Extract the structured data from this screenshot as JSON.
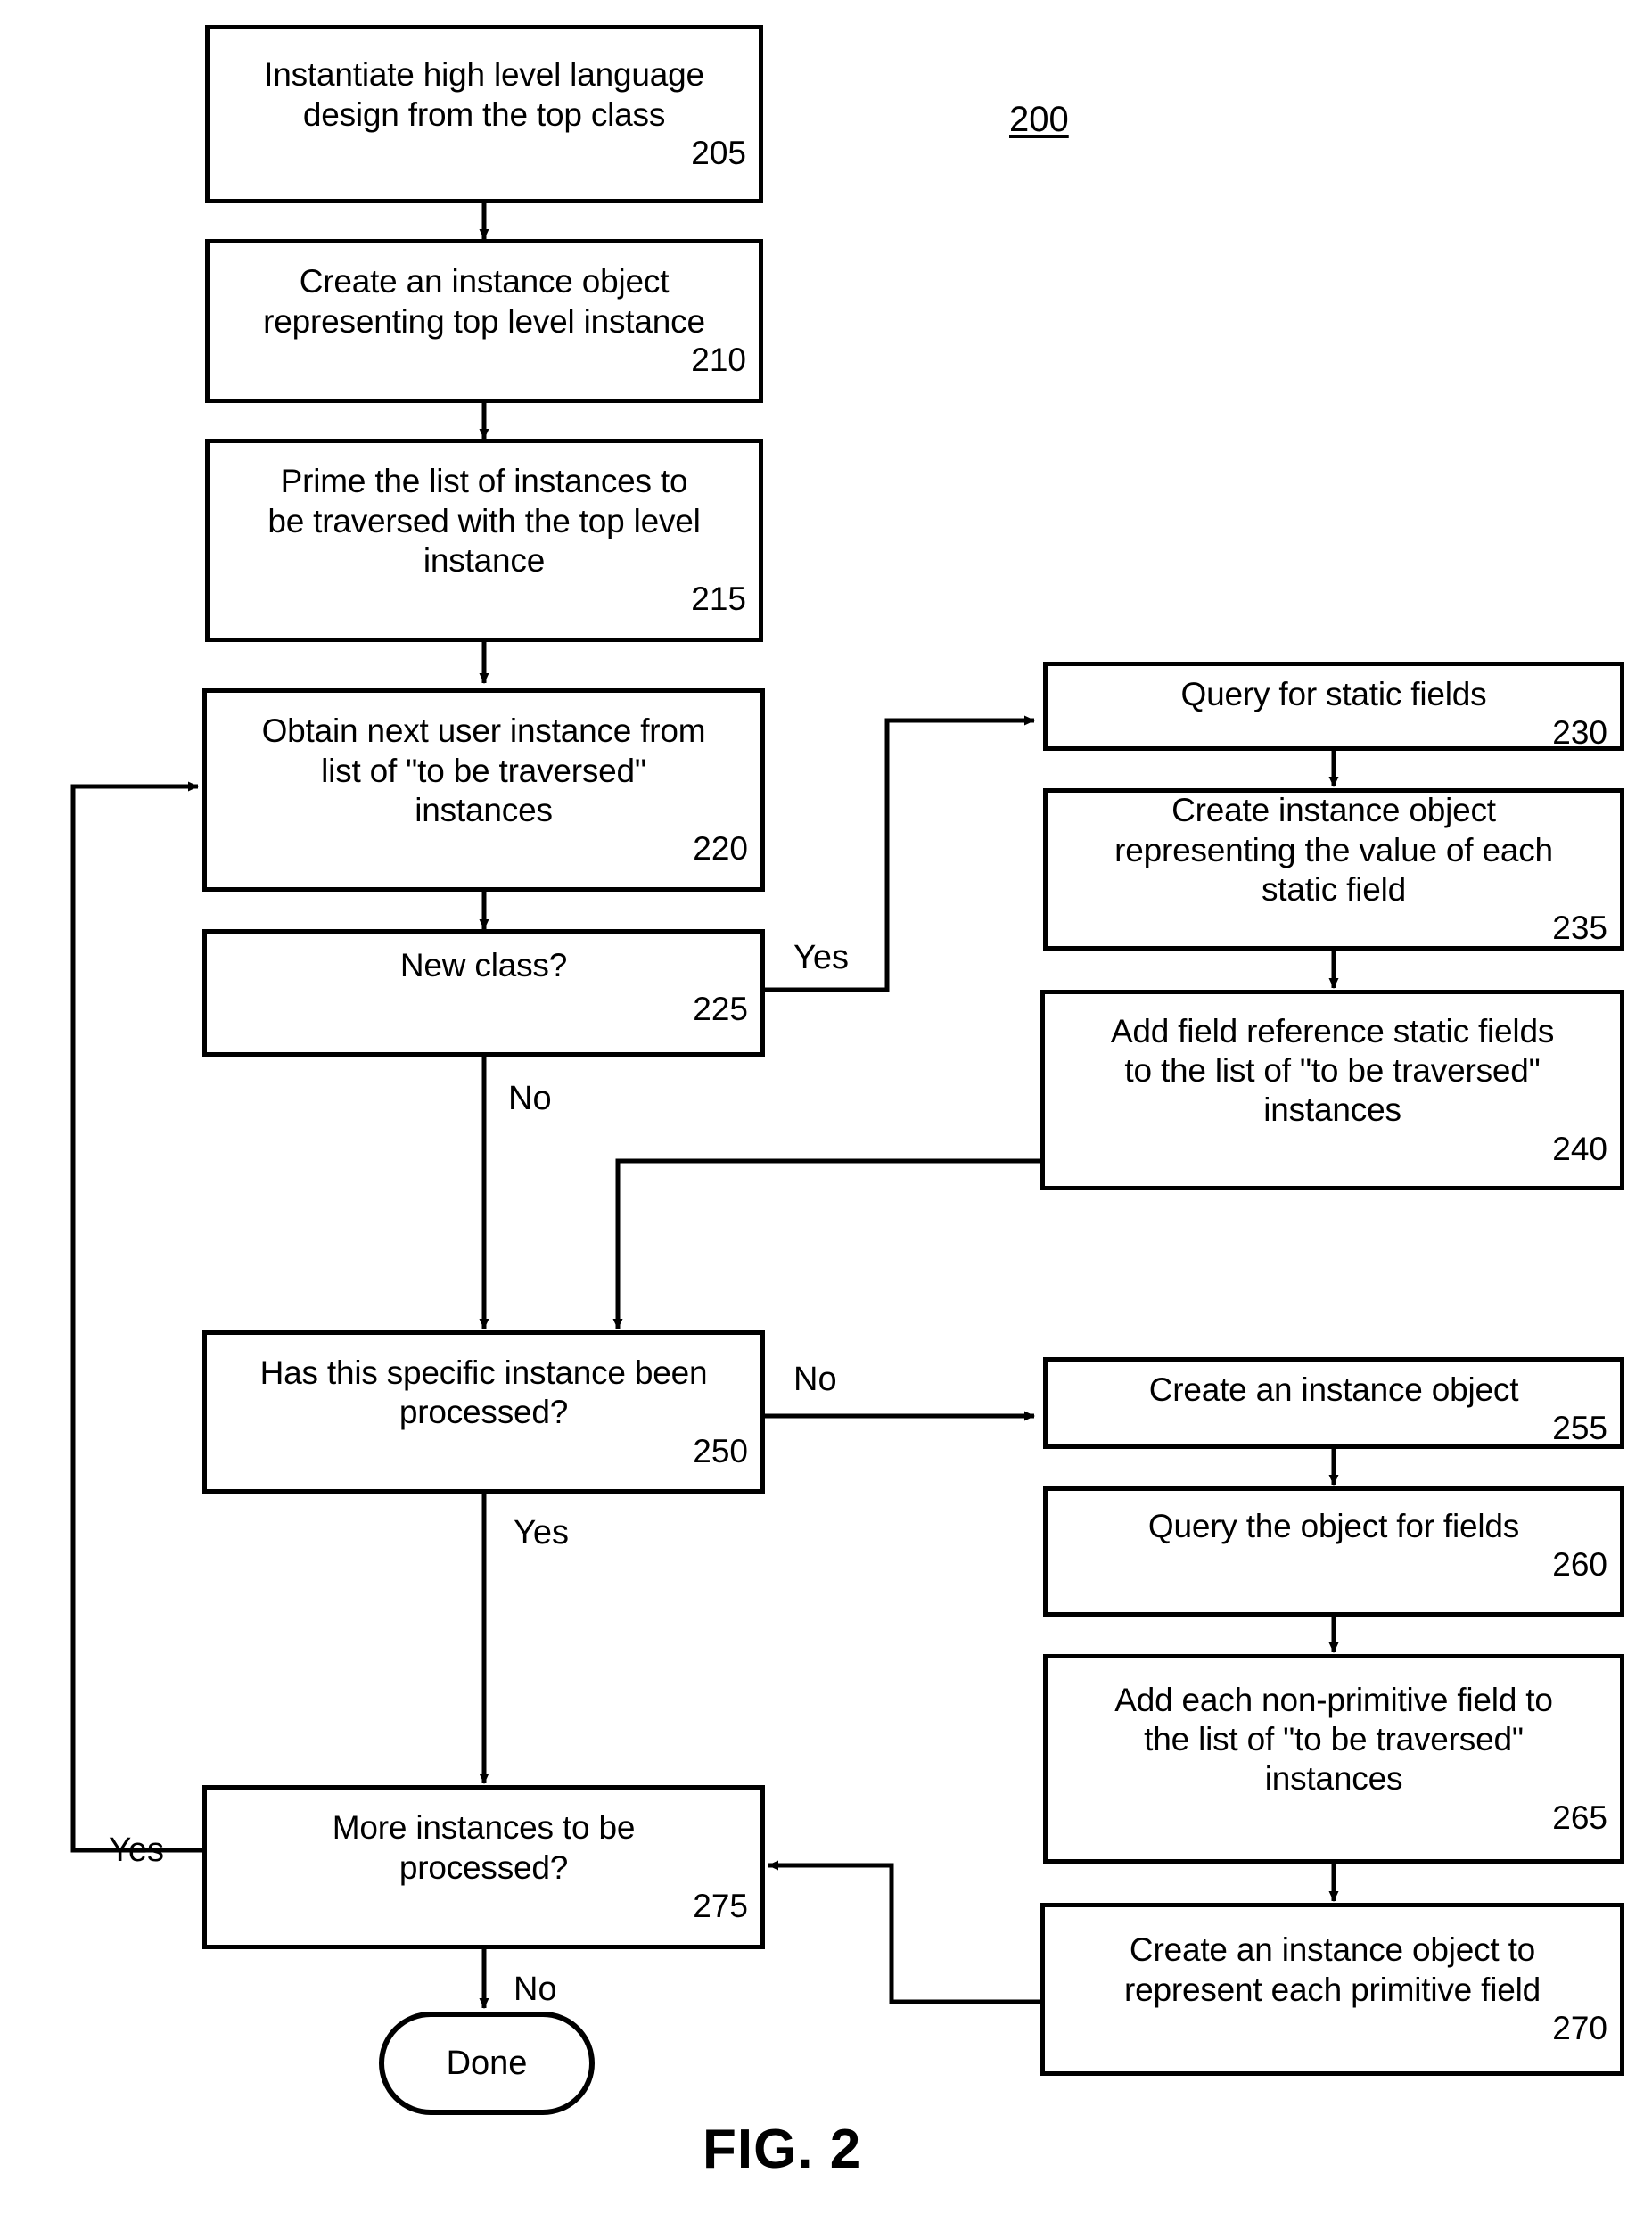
{
  "figure": {
    "caption": "FIG. 2",
    "reference_numeral": "200"
  },
  "nodes": [
    {
      "id": "205",
      "name": "instantiate-design",
      "text": "Instantiate high level language\ndesign from the top class",
      "ref": "205"
    },
    {
      "id": "210",
      "name": "create-top-level-instance-object",
      "text": "Create an instance object\nrepresenting top level instance",
      "ref": "210"
    },
    {
      "id": "215",
      "name": "prime-traversal-list",
      "text": "Prime the list of instances to\nbe traversed with the top level\ninstance",
      "ref": "215"
    },
    {
      "id": "220",
      "name": "obtain-next-user-instance",
      "text": "Obtain next user instance from\nlist of \"to be traversed\"\ninstances",
      "ref": "220"
    },
    {
      "id": "225",
      "name": "new-class-decision",
      "text": "New class?",
      "ref": "225"
    },
    {
      "id": "230",
      "name": "query-static-fields",
      "text": "Query for static fields",
      "ref": "230"
    },
    {
      "id": "235",
      "name": "create-static-field-value-object",
      "text": "Create instance object\nrepresenting the value of each\nstatic field",
      "ref": "235"
    },
    {
      "id": "240",
      "name": "add-field-reference-static-fields",
      "text": "Add field reference static fields\nto the list of \"to be traversed\"\ninstances",
      "ref": "240"
    },
    {
      "id": "250",
      "name": "instance-processed-decision",
      "text": "Has this specific instance been\nprocessed?",
      "ref": "250"
    },
    {
      "id": "255",
      "name": "create-instance-object",
      "text": "Create an instance object",
      "ref": "255"
    },
    {
      "id": "260",
      "name": "query-object-for-fields",
      "text": "Query the object for fields",
      "ref": "260"
    },
    {
      "id": "265",
      "name": "add-non-primitive-fields",
      "text": "Add each non-primitive field to\nthe list of \"to be traversed\"\ninstances",
      "ref": "265"
    },
    {
      "id": "270",
      "name": "create-primitive-field-object",
      "text": "Create an instance object to\nrepresent each primitive field",
      "ref": "270"
    },
    {
      "id": "275",
      "name": "more-instances-decision",
      "text": "More instances to be\nprocessed?",
      "ref": "275"
    }
  ],
  "terminal": {
    "name": "done-terminal",
    "text": "Done"
  },
  "edge_labels": [
    {
      "name": "edge-label-new-class-yes",
      "text": "Yes"
    },
    {
      "name": "edge-label-new-class-no",
      "text": "No"
    },
    {
      "name": "edge-label-processed-no",
      "text": "No"
    },
    {
      "name": "edge-label-processed-yes",
      "text": "Yes"
    },
    {
      "name": "edge-label-more-instances-yes",
      "text": "Yes"
    },
    {
      "name": "edge-label-more-instances-no",
      "text": "No"
    }
  ],
  "colors": {
    "stroke": "#000000",
    "background": "#ffffff"
  }
}
